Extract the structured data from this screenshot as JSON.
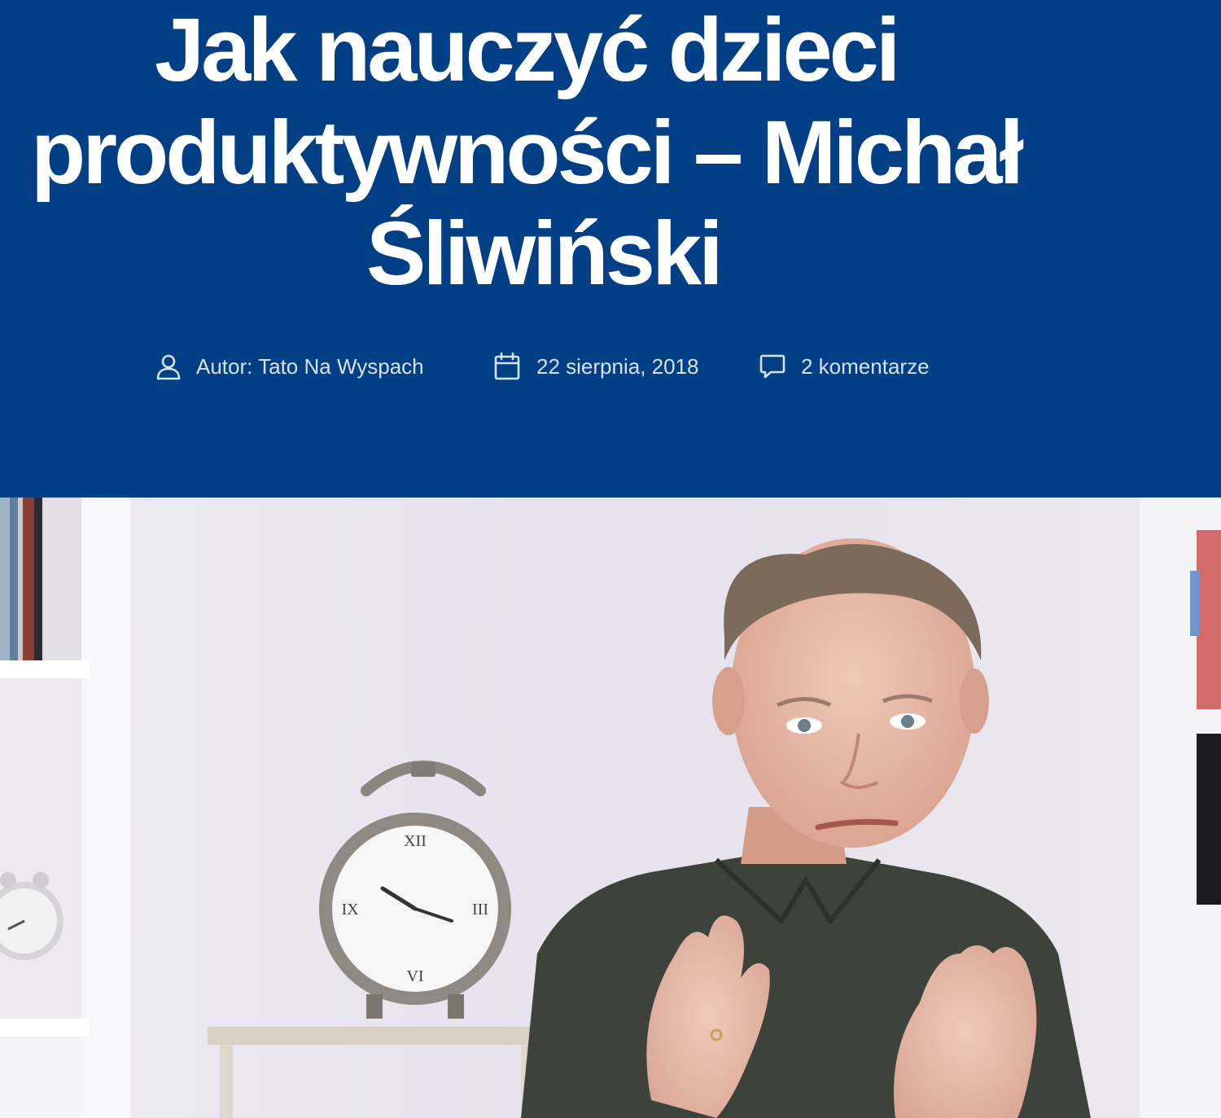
{
  "article": {
    "title_lines": [
      "Jak nauczyć dzieci",
      "produktywności – Michał",
      "Śliwiński"
    ]
  },
  "meta": {
    "author": "Autor: Tato Na Wyspach",
    "date": "22 sierpnia, 2018",
    "comments": "2 komentarze"
  },
  "colors": {
    "header_bg": "#033F84",
    "title": "#FFFFFF",
    "meta_text": "#D6E2F2"
  },
  "icons": {
    "author": "user-icon",
    "date": "calendar-icon",
    "comments": "comment-icon"
  }
}
